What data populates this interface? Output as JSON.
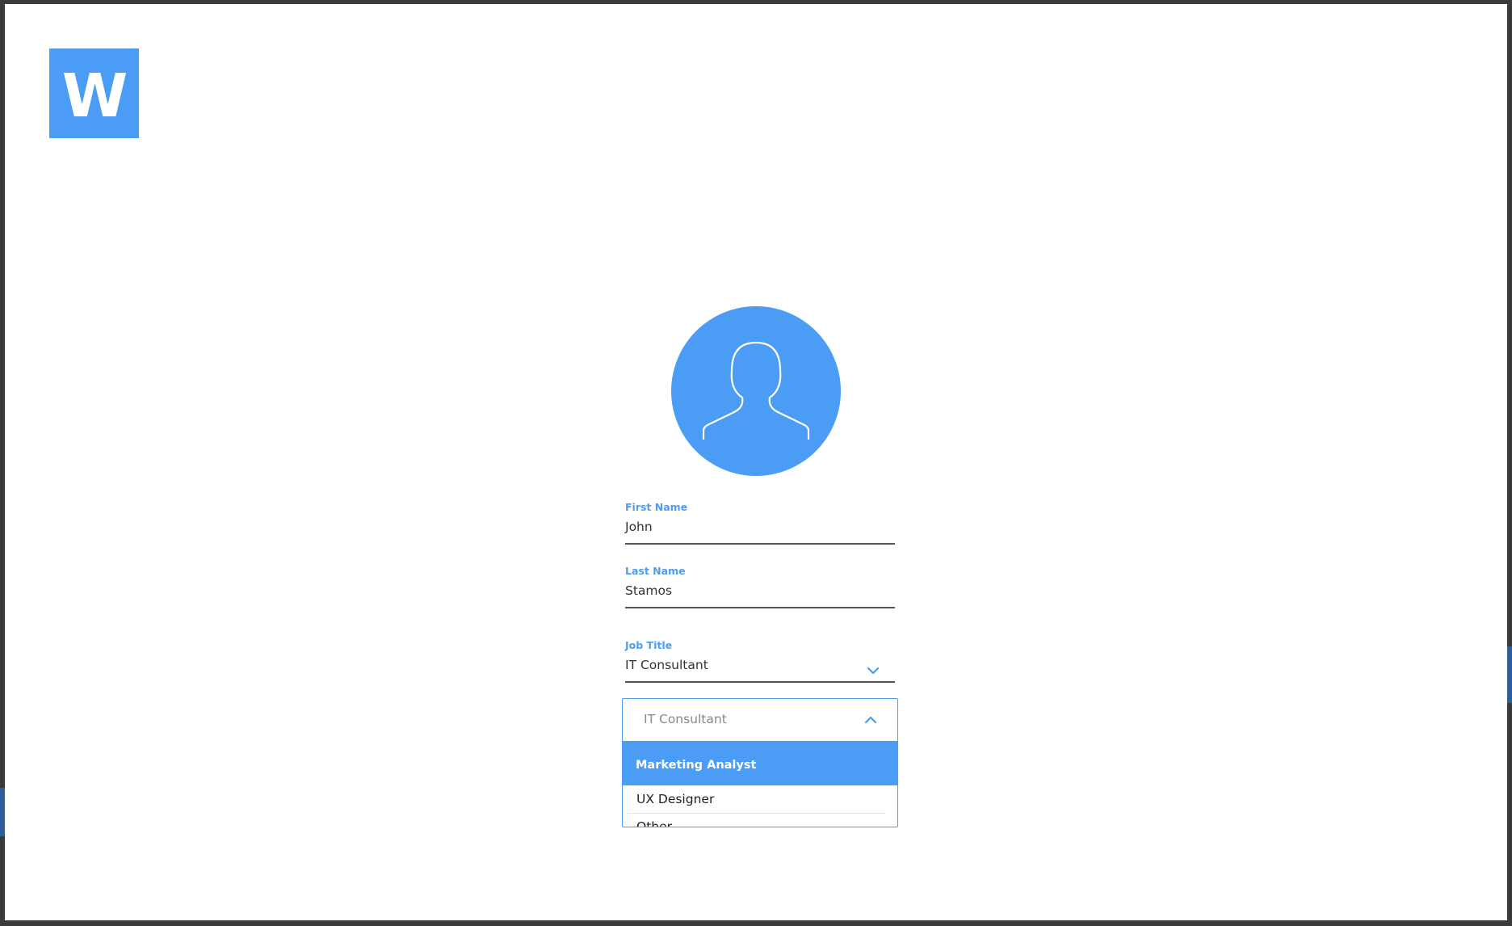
{
  "brand": {
    "logo_letter": "W",
    "accent_color": "#4a9cf5"
  },
  "avatar": {
    "icon": "user-silhouette-icon"
  },
  "form": {
    "first_name": {
      "label": "First Name",
      "value": "John"
    },
    "last_name": {
      "label": "Last Name",
      "value": "Stamos"
    },
    "job_title": {
      "label": "Job Title",
      "value": "IT Consultant",
      "icon": "chevron-down-icon"
    }
  },
  "dropdown": {
    "current_value": "IT Consultant",
    "icon": "chevron-up-icon",
    "options": [
      {
        "label": "Marketing Analyst",
        "highlighted": true
      },
      {
        "label": "UX Designer",
        "highlighted": false
      },
      {
        "label": "Other",
        "highlighted": false
      }
    ]
  }
}
